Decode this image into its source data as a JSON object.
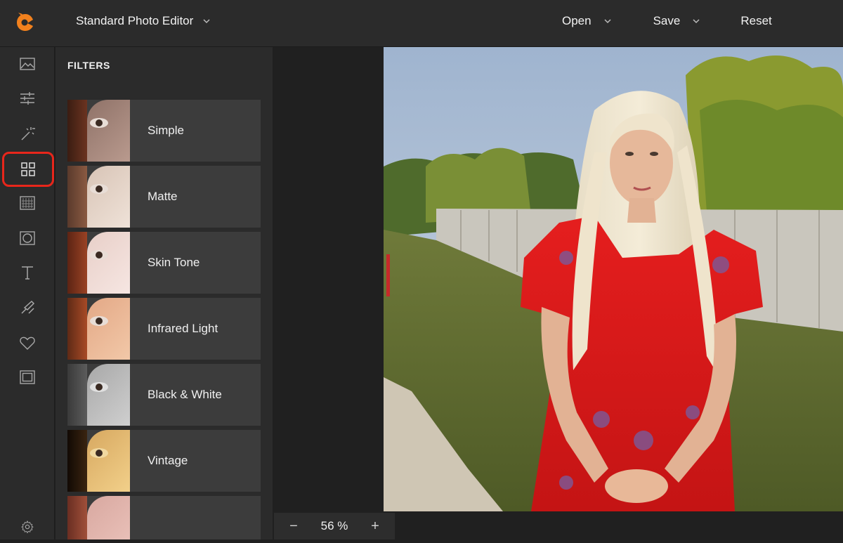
{
  "header": {
    "app_title": "Standard Photo Editor",
    "open_label": "Open",
    "save_label": "Save",
    "reset_label": "Reset",
    "brand_color": "#f2811d"
  },
  "rail": {
    "items": [
      {
        "name": "image-icon"
      },
      {
        "name": "adjust-sliders-icon"
      },
      {
        "name": "magic-wand-icon"
      },
      {
        "name": "filters-grid-icon",
        "active": true
      },
      {
        "name": "texture-icon"
      },
      {
        "name": "frame-icon"
      },
      {
        "name": "text-icon"
      },
      {
        "name": "brush-icon"
      },
      {
        "name": "heart-icon"
      },
      {
        "name": "border-icon"
      }
    ],
    "settings_icon": "gear-icon",
    "active_color": "#e8261b"
  },
  "filters": {
    "title": "FILTERS",
    "items": [
      {
        "label": "Simple"
      },
      {
        "label": "Matte"
      },
      {
        "label": "Skin Tone"
      },
      {
        "label": "Infrared Light"
      },
      {
        "label": "Black & White"
      },
      {
        "label": "Vintage"
      },
      {
        "label": ""
      }
    ]
  },
  "zoom": {
    "minus": "−",
    "value": "56 %",
    "plus": "+"
  }
}
